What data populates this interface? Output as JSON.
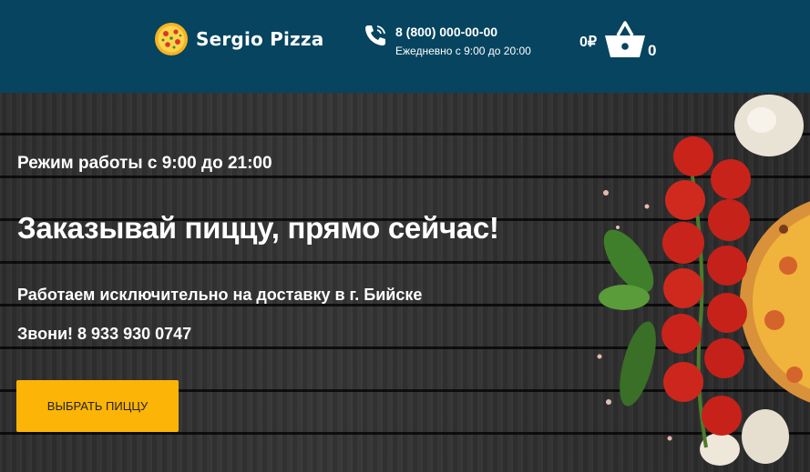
{
  "header": {
    "logo_text": "Sergio Pizza",
    "phone_number": "8 (800) 000-00-00",
    "phone_hours": "Ежедневно с 9:00 до 20:00",
    "cart_price": "0₽",
    "cart_count": "0",
    "icons": {
      "logo": "pizza-logo-icon",
      "phone": "phone-icon",
      "cart": "basket-icon"
    }
  },
  "hero": {
    "hours": "Режим работы с 9:00 до 21:00",
    "headline": "Заказывай пиццу, прямо сейчас!",
    "subline": "Работаем исключительно на доставку в г. Бийске",
    "call": "Звони! 8 933 930 0747",
    "cta_label": "ВЫБРАТЬ ПИЦЦУ"
  },
  "colors": {
    "header_bg": "#06445f",
    "cta_bg": "#fcb506",
    "text": "#ffffff"
  }
}
